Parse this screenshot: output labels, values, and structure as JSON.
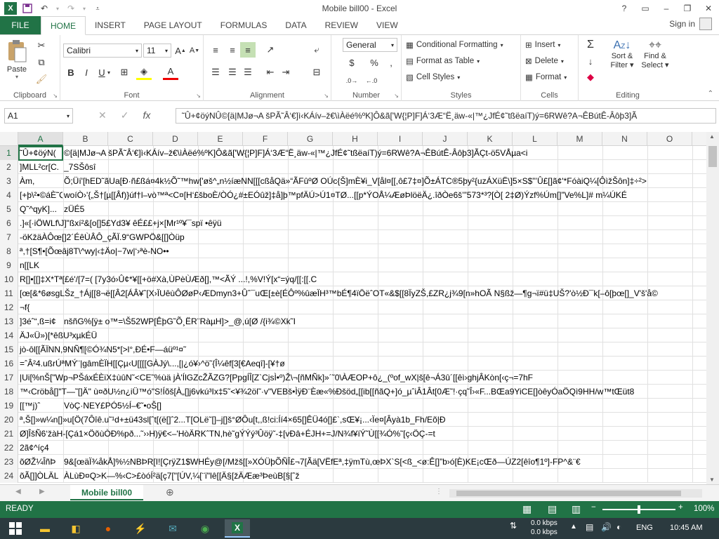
{
  "window": {
    "title": "Mobile bill00 - Excel"
  },
  "qat": {
    "save_icon": "save-icon",
    "undo_icon": "undo-icon",
    "redo_icon": "redo-icon"
  },
  "win_controls": {
    "help": "?",
    "minimize": "–",
    "restore": "❐",
    "close": "✕"
  },
  "tabs": [
    {
      "label": "FILE"
    },
    {
      "label": "HOME"
    },
    {
      "label": "INSERT"
    },
    {
      "label": "PAGE LAYOUT"
    },
    {
      "label": "FORMULAS"
    },
    {
      "label": "DATA"
    },
    {
      "label": "REVIEW"
    },
    {
      "label": "VIEW"
    }
  ],
  "signin": "Sign in",
  "ribbon": {
    "clipboard": {
      "label": "Clipboard",
      "paste": "Paste"
    },
    "font": {
      "label": "Font",
      "name": "Calibri",
      "size": "11"
    },
    "alignment": {
      "label": "Alignment"
    },
    "number": {
      "label": "Number",
      "format": "General"
    },
    "styles": {
      "label": "Styles",
      "conditional": "Conditional Formatting",
      "format_table": "Format as Table",
      "cell_styles": "Cell Styles"
    },
    "cells": {
      "label": "Cells",
      "insert": "Insert",
      "delete": "Delete",
      "format": "Format"
    },
    "editing": {
      "label": "Editing",
      "sort": "Sort &",
      "filter": "Filter",
      "find": "Find &",
      "select": "Select"
    }
  },
  "formula_bar": {
    "namebox": "A1",
    "fx": "fx",
    "content": "˜Û+¢öýNÛ©[ä|MJø¬A šPÃ˜Â‘€]ì‹KÁív–ž€\\ìÀëé%ºK]Ô&ã['W{¦P]F]Á‘3Æ“Ë¸äw-«|™¿JfÉ¢˜tßëaíT)ý=6RWê?A¬ÊBútÊ-Âôþ3]Ã"
  },
  "columns": [
    "A",
    "B",
    "C",
    "D",
    "E",
    "F",
    "G",
    "H",
    "I",
    "J",
    "K",
    "L",
    "M",
    "N",
    "O"
  ],
  "rows": [
    {
      "num": "1",
      "a": "˜Û+¢öýN(",
      "b": "©[ä|MJø¬A šPÃ˜Â‘€]ì‹KÁív–ž€\\ìÀëé%ºK]Ô&ã['W{¦P]F]Á‘3Æ“Ë¸äw-«|™¿JfÉ¢˜tßëaíT)ý=6RWê?A¬ÊBútÊ-Âôþ3]ÃÇt-ö5VÅµa<i"
    },
    {
      "num": "2",
      "a": "]MLL²cr[C.",
      "b": "_7SŠôsî"
    },
    {
      "num": "3",
      "a": "Àm,",
      "b": "Õ;Üí'[hED˜ãUa[Ð·ñ£ßá¤4k½Õ˜™hw['øš^„n½íæNN[[[cßåQä»“ÃFûºØ OÚc{Š]mÈ¥i_V[ål¤[[,ô£7‡¤]Õ±ÁTC®5þy²{uzÁXüË\\]5×S$”’Û£[]ã¢'*FóàiQ¼[ÔìžŠôn]‡÷²>"
    },
    {
      "num": "4",
      "a": "[+þ\\²•©áÈ˜Q$...",
      "b": "woíÒ›'{„Š†[µ[[Âf)}úf†l–vò™ª<C¤[H‘£šboÈ/ÒÓ¿#±EÓûž]‡å]þ™pfÄÚ>Ú1¤TØ...[[p*ÝOÅ¼ÆøÞlöëÄ¿.îðÒe6š’”573*³?[Ò[ 2‡Ø)Ýzf%Úm[]”Ve%L]# m¼ÚKÉ"
    },
    {
      "num": "5",
      "a": "Q˜^qyK]...",
      "b": "zÜÉ5"
    },
    {
      "num": "6",
      "a": ".]«[·iÖWLf\\J]\"ßxí²&[o[]5£Yd3¥ êÉ££+j×[Mr¹º¥¯spï •êÿü",
      "b": ""
    },
    {
      "num": "7",
      "a": "-öKžäÀÔœ[]2´ÉêÙÂÔ_çÃÏ.9“GWPÖ&[[]Òüp",
      "b": ""
    },
    {
      "num": "8",
      "a": "ª,†[S¶•[Õœâj8T\\^wy|‹‡Äo|−7w|‘›ªè-NO••",
      "b": ""
    },
    {
      "num": "9",
      "a": "n[[LK",
      "b": ""
    },
    {
      "num": "10",
      "a": "R[]•[[]‡X*Tª[£é'/[7=( [7y3ó›Û¢*¥[[+ö#Xà,ÙPèÙÆð[],™<ÃÝ ...!,%V!Ý[x“=ýq/[[:[[.C",
      "b": ""
    },
    {
      "num": "11",
      "a": "[œ[&*6øsgLŠz_†Áj[[8¬ë[[Â2[ÁÂ¥ˆ[X›ÏUêùÔØøP‹ÆDmyn3+Ûˆ¯uŒ[±è[ÉÔº%ûæÏH³™bÉ¶4ïÖëˆOT«&$[[8ÏyZŠ,£ZR¿j¾9[n»hOÃ N§ßž—¶g¬ï#ü‡UŠ?'ò½Ð¯k[–ô[þœ[]_V'š'å©",
      "b": ""
    },
    {
      "num": "12",
      "a": "¬f{",
      "b": ""
    },
    {
      "num": "13",
      "a": "]3éˆ“,ß=i¢",
      "b": "nšñG%[ÿ± o™=\\Š52WP[ÊþG˜Õ¸ËR¨RàµH]>_@,ú[Ø /{i¾©Xk˜I"
    },
    {
      "num": "14",
      "a": "ÄJ«Ü»)[*êßU³xµkÉÜ",
      "b": ""
    },
    {
      "num": "15",
      "a": "jò-ôl[[ÃÏNN,9NÑ¶[©Ó¾N5*[>l°,ÐÉ•F—áüº¹¤˜",
      "b": ""
    },
    {
      "num": "16",
      "a": "=ˆÂ²4.ußrÚªMÝ¨|gâmÈÏH[[Çµ‹U[[[[GÀJý\\...,[|¿ó¥›^ö˜{Î¼êf[3[€Aeqî]-[¥†ø",
      "b": ""
    },
    {
      "num": "17",
      "a": "|Ui[%nŠ[\"Wp¬PŠáxÉÈiX‡ùûN˜<CE˜%ùä jÀ'ÍlGZcŽÃZG?[PpgÍÎ[Z`CjsÌ•º)Ž\\¬[ñMÑk]»´˜0\\ÀÆOP+ô¿_(ºof_wX|š[ê¬Á3û´[[êì›ghjÂKòn[‹ç¬=7hF",
      "b": ""
    },
    {
      "num": "18",
      "a": "™‹Cröbå[]\"T—˜[]Ä\" ù¤ðU½n¿iÜ™ó\"S!Íõš[À„[]j6vkú³Ix‡5˜<¥¾2öl˜·v\"VEBš•ÌÿÐ¨Èæ«%Ðšöd„[[ib[[ñãQ+]ó_µˆiÂ1Ât[0Æ˜!·çq˜Î›«F...BŒa9YiCE[]òêyÓaÖQì9HH/w™tŒüt8",
      "b": ""
    },
    {
      "num": "19",
      "a": "[[™j)ˆ",
      "b": "VòÇ·NEY£PÓ5½Í–€˜•oŠ[]"
    },
    {
      "num": "20",
      "a": "ª,Š[]»w¼n[]»u[Ö(7Ôîê.u˜¹d+±ü43sl[ˆt[(ë[]ˆ2...T[OLë˜[]–j[]š°ØÔu[t,,ß!ci:Íí4×65[]ÊÜ4ó[]£`,sŒ¥¡...‹Ïe¤[Âyà1b_Fh/Eõ|Ð",
      "b": ""
    },
    {
      "num": "21",
      "a": "Ø]ÎšÑ6‘žàH-[Çá1×ÖõùÒÐ%pð...˜››H)ÿ€<–'HòÄRKˆTN,hè˜gÝÝý³Ûöÿ˜-‡[vÐâ+ÉJH+=J/N¾f¥íÝ˜Ù[[¾Ó%˜[ç‹ÖÇ-=t",
      "b": ""
    },
    {
      "num": "22",
      "a": "2ã¢^íç4",
      "b": ""
    },
    {
      "num": "23",
      "a": "õØŽ¼ÎñÞ",
      "b": "9&[œäÏ¾åkÅ]%½NBÞR[I![ÇrÿZ1$WHÉy@[/Mžš[[»XÓÜþÕÑÎ£¬7[Ãä[VËfEª,‡ÿmTù,œÞX`S[<ß_<ø:Ê[]”b›ó[È)KE¡cŒð—ÚZ2[êîo¶1º]-FP^&¨€"
    },
    {
      "num": "24",
      "a": "õÃ[]]ÒLÄL",
      "b": "ÀLùÐ¤Q>K—%‹C>£òóÍ²ä[ç7[\"[ÚV,¼[¨ï\"lê[[Ä§[žÄÆæ³ÞeùB[§[ˆž"
    }
  ],
  "sheet": {
    "name": "Mobile bill00"
  },
  "status": {
    "ready": "READY",
    "zoom": "100%"
  },
  "taskbar": {
    "lang": "ENG",
    "time": "10:45 AM",
    "net_up": "0.0 kbps",
    "net_down": "0.0 kbps"
  }
}
